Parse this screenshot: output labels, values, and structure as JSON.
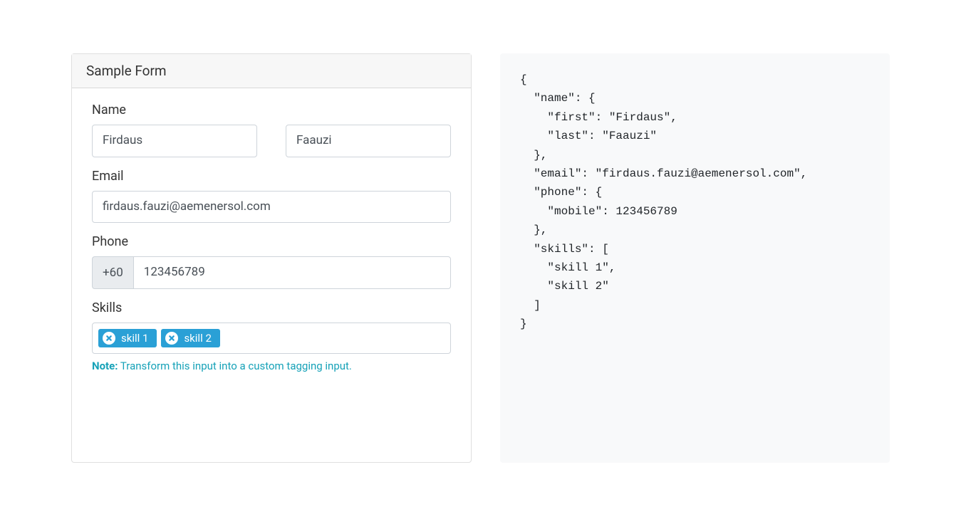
{
  "card": {
    "title": "Sample Form"
  },
  "form": {
    "name": {
      "label": "Name",
      "first_value": "Firdaus",
      "last_value": "Faauzi"
    },
    "email": {
      "label": "Email",
      "value": "firdaus.fauzi@aemenersol.com"
    },
    "phone": {
      "label": "Phone",
      "prefix": "+60",
      "value": "123456789"
    },
    "skills": {
      "label": "Skills",
      "tags": [
        "skill 1",
        "skill 2"
      ],
      "note_label": "Note:",
      "note_text": " Transform this input into a custom tagging input."
    }
  },
  "json_output": "{\n  \"name\": {\n    \"first\": \"Firdaus\",\n    \"last\": \"Faauzi\"\n  },\n  \"email\": \"firdaus.fauzi@aemenersol.com\",\n  \"phone\": {\n    \"mobile\": 123456789\n  },\n  \"skills\": [\n    \"skill 1\",\n    \"skill 2\"\n  ]\n}"
}
